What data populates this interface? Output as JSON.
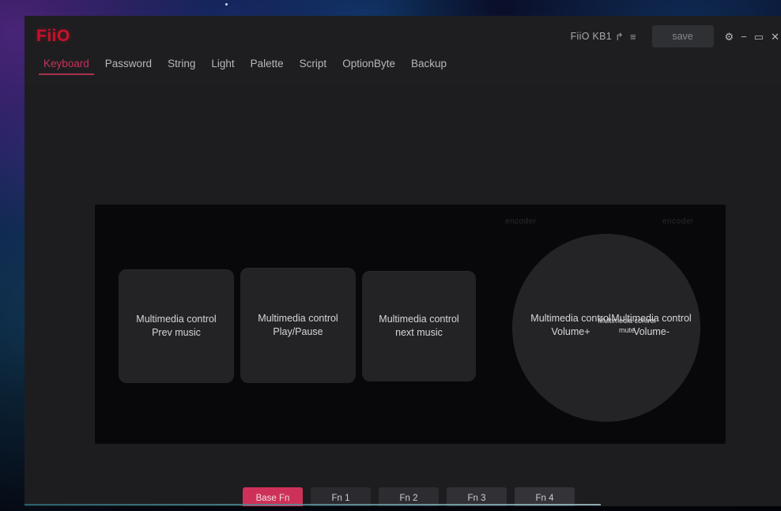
{
  "app": {
    "brand": "FiiO",
    "device_name": "FiiO KB1",
    "edit_icon": "edit-square-icon",
    "menu_icon": "hamburger-menu-icon",
    "save_label": "save",
    "accent_color": "#c8122b",
    "active_fn_color": "#cd3159",
    "window_controls": {
      "settings": "⚙",
      "minimize": "−",
      "maximize": "▭",
      "close": "✕"
    },
    "titlebar_icons": {
      "edit": "↱",
      "menu": "≡"
    }
  },
  "nav": {
    "tabs": [
      {
        "label": "Keyboard",
        "active": true
      },
      {
        "label": "Password",
        "active": false
      },
      {
        "label": "String",
        "active": false
      },
      {
        "label": "Light",
        "active": false
      },
      {
        "label": "Palette",
        "active": false
      },
      {
        "label": "Script",
        "active": false
      },
      {
        "label": "OptionByte",
        "active": false
      },
      {
        "label": "Backup",
        "active": false
      }
    ]
  },
  "keyboard": {
    "keys": [
      {
        "name": "prev-music",
        "line1": "Multimedia control",
        "line2": "Prev music"
      },
      {
        "name": "play-pause",
        "line1": "Multimedia control",
        "line2": "Play/Pause"
      },
      {
        "name": "next-music",
        "line1": "Multimedia control",
        "line2": "next music"
      }
    ],
    "dial": {
      "volume_up": {
        "line1": "Multimedia control",
        "line2": "Volume+"
      },
      "mute": {
        "line1": "Multimedia control",
        "line2": "mute"
      },
      "volume_down": {
        "line1": "Multimedia control",
        "line2": "Volume-"
      },
      "tick_left": "encoder",
      "tick_right": "encoder"
    }
  },
  "fn_layers": {
    "buttons": [
      {
        "label": "Base Fn",
        "active": true
      },
      {
        "label": "Fn 1",
        "active": false
      },
      {
        "label": "Fn 2",
        "active": false
      },
      {
        "label": "Fn 3",
        "active": false
      },
      {
        "label": "Fn 4",
        "active": false
      }
    ]
  }
}
